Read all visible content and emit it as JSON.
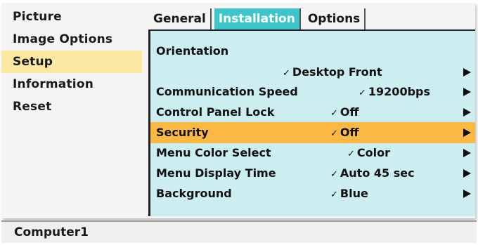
{
  "sidebar": {
    "items": [
      {
        "label": "Picture"
      },
      {
        "label": "Image Options"
      },
      {
        "label": "Setup"
      },
      {
        "label": "Information"
      },
      {
        "label": "Reset"
      }
    ],
    "active_index": 2
  },
  "tabs": [
    {
      "label": "General"
    },
    {
      "label": "Installation"
    },
    {
      "label": "Options"
    }
  ],
  "active_tab": 1,
  "settings": {
    "orientation": {
      "label": "Orientation",
      "value": "Desktop Front",
      "check": "✓"
    },
    "communication_speed": {
      "label": "Communication Speed",
      "value": "19200bps",
      "check": "✓"
    },
    "control_panel_lock": {
      "label": "Control Panel Lock",
      "value": "Off",
      "check": "✓"
    },
    "security": {
      "label": "Security",
      "value": "Off",
      "check": "✓"
    },
    "menu_color_select": {
      "label": "Menu Color Select",
      "value": "Color",
      "check": "✓"
    },
    "menu_display_time": {
      "label": "Menu Display Time",
      "value": "Auto 45 sec",
      "check": "✓"
    },
    "background": {
      "label": "Background",
      "value": "Blue",
      "check": "✓"
    }
  },
  "highlighted_setting": "security",
  "status": {
    "source": "Computer1"
  },
  "colors": {
    "active_tab": "#3ec5c9",
    "content_bg": "#cdeef0",
    "highlight_row": "#fbb944",
    "active_sidebar": "#fbe9a3"
  },
  "icons": {
    "submenu": "right-triangle-icon",
    "selected": "checkmark-icon"
  }
}
